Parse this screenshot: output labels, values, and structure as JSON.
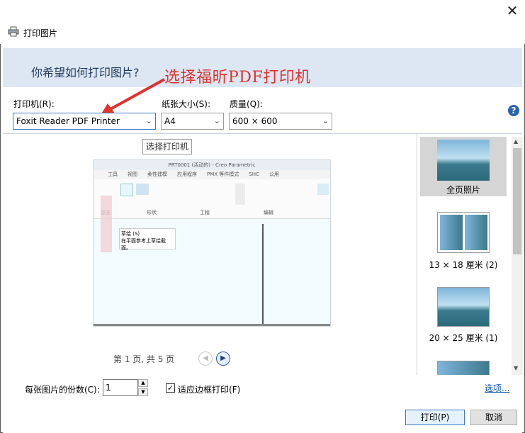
{
  "window": {
    "title": "打印图片",
    "close_glyph": "✕"
  },
  "banner": {
    "question": "你希望如何打印图片?"
  },
  "annotation": {
    "text": "选择福昕PDF打印机",
    "color": "#e0322f"
  },
  "fields": {
    "printer_label": "打印机(R):",
    "printer_value": "Foxit Reader PDF Printer",
    "paper_label": "纸张大小(S):",
    "paper_value": "A4",
    "quality_label": "质量(Q):",
    "quality_value": "600 × 600",
    "help_glyph": "?"
  },
  "preview": {
    "tooltip": "选择打印机",
    "page_status": "第 1 页, 共 5 页",
    "inner_title": "PRT0001 (活动的) - Creo Parametric",
    "inner_tabs": [
      "工具",
      "视图",
      "柔性建模",
      "应用程序",
      "PMX 等件模式",
      "SHC",
      "公用"
    ],
    "inner_groups": [
      "基准",
      "形状",
      "工程",
      "编辑"
    ],
    "inner_popup_title": "草绘 (S)",
    "inner_popup_text": "在平面参考上草绘截面。"
  },
  "layouts": [
    {
      "label": "全页照片",
      "selected": true
    },
    {
      "label": "13 × 18 厘米 (2)",
      "selected": false
    },
    {
      "label": "20 × 25 厘米 (1)",
      "selected": false
    }
  ],
  "bottom": {
    "copies_label": "每张图片的份数(C):",
    "copies_value": "1",
    "fit_label": "适应边框打印(F)",
    "fit_checked": "✓",
    "options_link": "选项...",
    "print_button": "打印(P)",
    "cancel_button": "取消"
  },
  "colors": {
    "banner": "#dce7f3",
    "accent": "#3b78c8",
    "link": "#0b52b5"
  }
}
